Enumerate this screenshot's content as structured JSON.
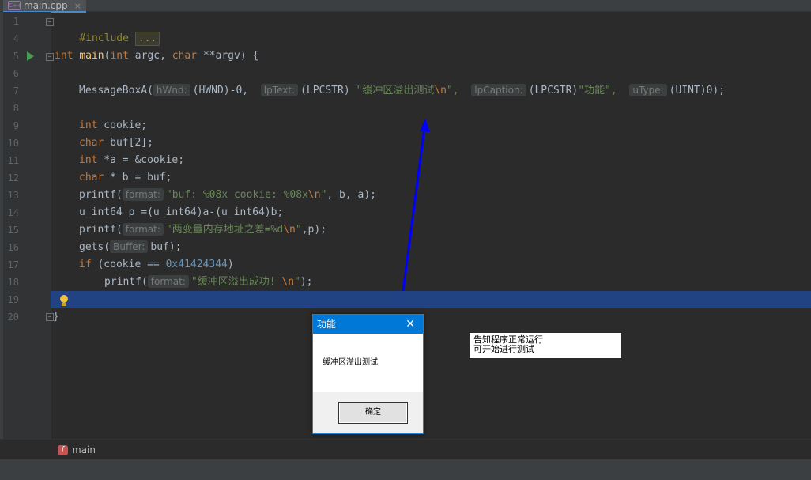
{
  "tab": {
    "filename": "main.cpp",
    "close": "×",
    "icon": "cpp-file-icon"
  },
  "code_lines": [
    {
      "n": "1"
    },
    {
      "n": "4"
    },
    {
      "n": "5"
    },
    {
      "n": "6"
    },
    {
      "n": "7"
    },
    {
      "n": "8"
    },
    {
      "n": "9"
    },
    {
      "n": "10"
    },
    {
      "n": "11"
    },
    {
      "n": "12"
    },
    {
      "n": "13"
    },
    {
      "n": "14"
    },
    {
      "n": "15"
    },
    {
      "n": "16"
    },
    {
      "n": "17"
    },
    {
      "n": "18"
    },
    {
      "n": "19"
    },
    {
      "n": "20"
    }
  ],
  "code": {
    "l1_include": "#include",
    "l1_folded": "...",
    "l5": {
      "kw": "int",
      "fn": "main",
      "rest1": "(",
      "kw2": "int",
      "rest2": " argc, ",
      "kw3": "char",
      "rest3": " **argv) {"
    },
    "l7": {
      "call": "MessageBoxA(",
      "h1": "hWnd:",
      "a1": "(HWND)-0,",
      "h2": "lpText:",
      "a2p": "(LPCSTR) ",
      "a2s": "\"缓冲区溢出测试",
      "a2e": "\\n",
      "a2s2": "\",",
      "h3": "lpCaption:",
      "a3p": "(LPCSTR)",
      "a3s": "\"功能\",",
      "h4": "uType:",
      "a4": "(UINT)0);"
    },
    "l9": {
      "kw": "int",
      "rest": " cookie;"
    },
    "l10": {
      "kw": "char",
      "rest": " buf[2];"
    },
    "l11": {
      "kw": "int",
      "rest": " *a = &cookie;"
    },
    "l12": {
      "kw": "char",
      "rest": " * b = buf;"
    },
    "l13": {
      "call": "printf(",
      "hint": "format:",
      "s": "\"buf: %08x cookie: %08x",
      "e": "\\n",
      "s2": "\"",
      "rest": ", b, a);"
    },
    "l14": {
      "text": "u_int64 p =(u_int64)a-(u_int64)b;"
    },
    "l15": {
      "call": "printf(",
      "hint": "format:",
      "s": "\"两变量内存地址之差=%d",
      "e": "\\n",
      "s2": "\"",
      "rest": ",p);"
    },
    "l16": {
      "call": "gets(",
      "hint": "Buffer:",
      "rest": "buf);"
    },
    "l17": {
      "kw": "if",
      "rest": " (cookie == ",
      "num": "0x41424344",
      "rest2": ")"
    },
    "l18": {
      "call": "printf(",
      "hint": "format:",
      "s": "\"缓冲区溢出成功! ",
      "e": "\\n",
      "s2": "\"",
      "rest": ");"
    },
    "l20": {
      "brace": "}"
    }
  },
  "breadcrumb": {
    "icon_letter": "f",
    "label": "main"
  },
  "dialog": {
    "title": "功能",
    "close": "✕",
    "message": "缓冲区溢出测试",
    "ok": "确定"
  },
  "note": {
    "line1": "告知程序正常运行",
    "line2": "可开始进行测试"
  },
  "colors": {
    "editor_bg": "#2b2b2b",
    "selection": "#214283",
    "arrow": "#0000ff",
    "dialog_title": "#0078d7"
  }
}
